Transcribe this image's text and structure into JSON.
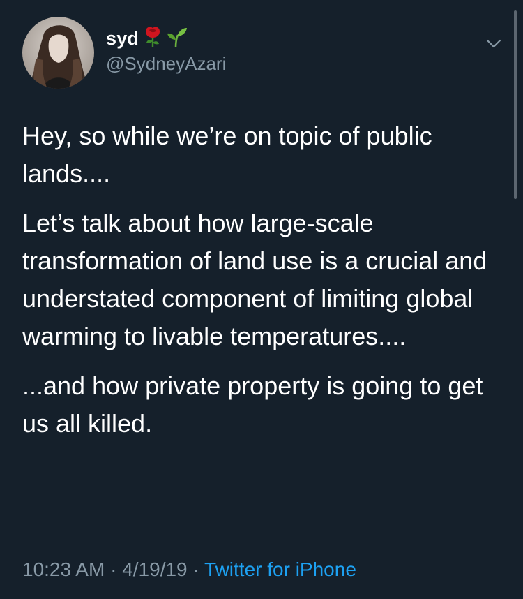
{
  "user": {
    "display_name": "syd",
    "emojis": [
      "rose-emoji",
      "seedling-emoji"
    ],
    "handle": "@SydneyAzari"
  },
  "tweet": {
    "paragraphs": [
      "Hey, so while we’re on topic of public lands....",
      "Let’s talk about how large-scale transformation of land use is a crucial and understated component of limiting global warming to livable temperatures....",
      "...and how private property is going to get us all killed."
    ],
    "time": "10:23 AM",
    "separator": "·",
    "date": "4/19/19",
    "source": "Twitter for iPhone"
  },
  "colors": {
    "background": "#15202b",
    "text": "#ffffff",
    "secondary": "#8899a6",
    "link": "#1da1f2"
  },
  "icons": {
    "menu": "chevron-down-icon"
  }
}
